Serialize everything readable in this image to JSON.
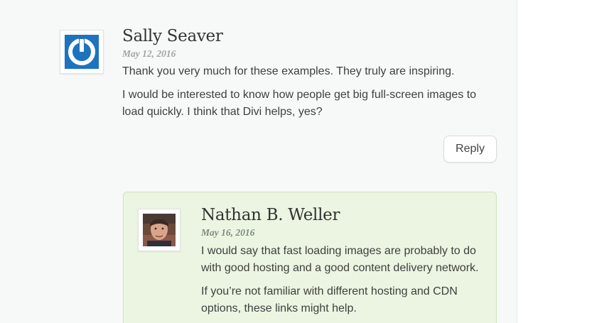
{
  "comments": [
    {
      "author": "Sally Seaver",
      "date": "May 12, 2016",
      "paragraphs": [
        "Thank you very much for these examples. They truly are inspiring.",
        "I would be interested to know how people get big full-screen images to load quickly. I think that Divi helps, yes?"
      ],
      "reply_label": "Reply",
      "avatar_icon": "power-logo-icon"
    }
  ],
  "reply": {
    "author": "Nathan B. Weller",
    "date": "May 16, 2016",
    "paragraphs": [
      "I would say that fast loading images are probably to do with good hosting and a good content delivery network.",
      "If you’re not familiar with different hosting and CDN options, these links might help."
    ],
    "avatar_icon": "profile-photo"
  },
  "colors": {
    "background": "#f7f8f8",
    "nested_background": "#ebf5e2",
    "nested_border": "#cfe3be",
    "gravatar_blue": "#1e73be"
  }
}
